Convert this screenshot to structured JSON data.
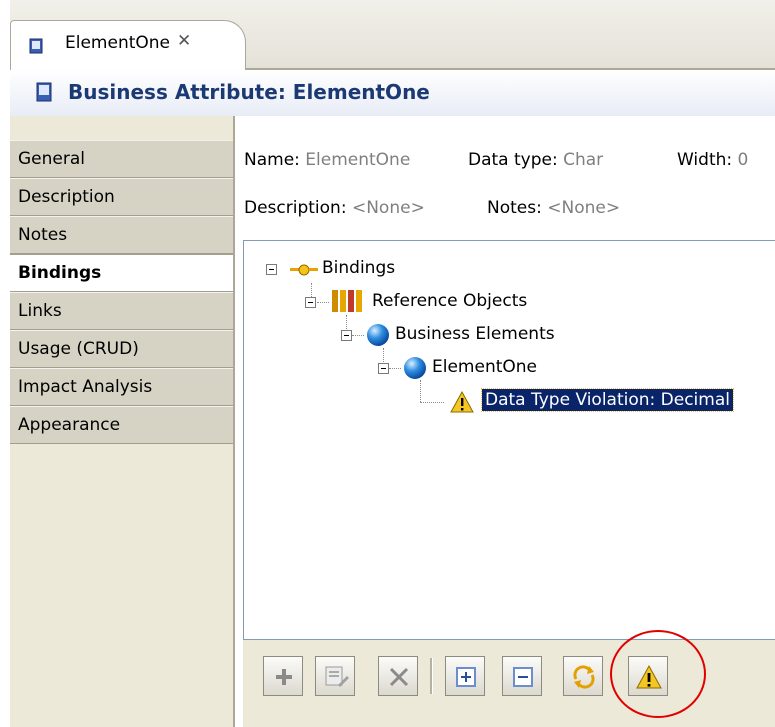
{
  "editor_tab": {
    "label": "ElementOne",
    "close_glyph": "✕"
  },
  "header": {
    "title": "Business Attribute: ElementOne"
  },
  "sidebar": {
    "items": [
      {
        "label": "General"
      },
      {
        "label": "Description"
      },
      {
        "label": "Notes"
      },
      {
        "label": "Bindings",
        "active": true
      },
      {
        "label": "Links"
      },
      {
        "label": "Usage (CRUD)"
      },
      {
        "label": "Impact Analysis"
      },
      {
        "label": "Appearance"
      }
    ]
  },
  "properties": {
    "name_label": "Name:",
    "name_value": "ElementOne",
    "datatype_label": "Data type:",
    "datatype_value": "Char",
    "width_label": "Width:",
    "width_value": "0",
    "description_label": "Description:",
    "description_value": "<None>",
    "notes_label": "Notes:",
    "notes_value": "<None>"
  },
  "tree": {
    "root": "Bindings",
    "reference_objects": "Reference Objects",
    "business_elements": "Business Elements",
    "element": "ElementOne",
    "violation": "Data Type Violation: Decimal"
  },
  "toolbar": {
    "buttons": [
      "add-icon",
      "edit-icon",
      "delete-icon",
      "expand-all-icon",
      "collapse-all-icon",
      "refresh-icon",
      "warning-icon"
    ]
  },
  "colors": {
    "title_text": "#1b3a74",
    "selection": "#0a246a",
    "annotation_circle": "#e00000"
  }
}
